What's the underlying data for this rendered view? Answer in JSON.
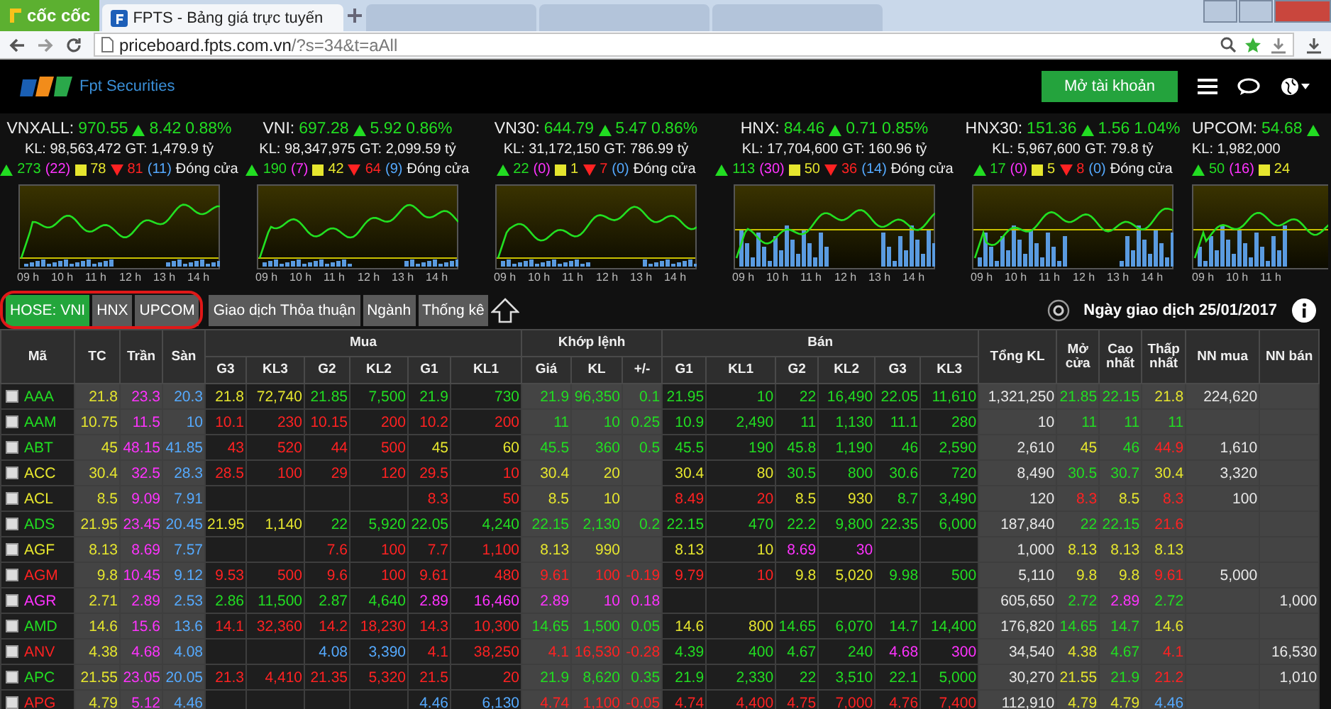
{
  "browser": {
    "brand": "cốc cốc",
    "tabs": [
      {
        "title": "FPTS - Bảng giá trực tuyến",
        "selected": true
      },
      {
        "selected": false
      },
      {
        "selected": false
      },
      {
        "selected": false
      }
    ],
    "url_host": "priceboard.fpts.com.vn",
    "url_path": "/?s=34&t=aAll"
  },
  "site": {
    "logo_text": "Fpt Securities",
    "open_account": "Mở tài khoản"
  },
  "indices": [
    {
      "name": "VNXALL:",
      "value": "970.55",
      "change": "8.42",
      "percent": "0.88%",
      "volume": "KL: 98,563,472",
      "value_traded": "GT: 1,479.9 tỷ",
      "advances": "273",
      "ceiling": "(22)",
      "unchanged": "78",
      "declines": "81",
      "floor": "(11)",
      "status": "Đóng cửa",
      "time_labels": [
        "09 h",
        "10 h",
        "11 h",
        "12 h",
        "13 h",
        "14 h"
      ]
    },
    {
      "name": "VNI:",
      "value": "697.28",
      "change": "5.92",
      "percent": "0.86%",
      "volume": "KL: 98,347,975",
      "value_traded": "GT: 2,099.59 tỷ",
      "advances": "190",
      "ceiling": "(7)",
      "unchanged": "42",
      "declines": "64",
      "floor": "(9)",
      "status": "Đóng cửa",
      "time_labels": [
        "09 h",
        "10 h",
        "11 h",
        "12 h",
        "13 h",
        "14 h"
      ]
    },
    {
      "name": "VN30:",
      "value": "644.79",
      "change": "5.47",
      "percent": "0.86%",
      "volume": "KL: 31,172,150",
      "value_traded": "GT: 786.99 tỷ",
      "advances": "22",
      "ceiling": "(0)",
      "unchanged": "1",
      "declines": "7",
      "floor": "(0)",
      "status": "Đóng cửa",
      "time_labels": [
        "09 h",
        "10 h",
        "11 h",
        "12 h",
        "13 h",
        "14 h"
      ]
    },
    {
      "name": "HNX:",
      "value": "84.46",
      "change": "0.71",
      "percent": "0.85%",
      "volume": "KL: 17,704,600",
      "value_traded": "GT: 160.96 tỷ",
      "advances": "113",
      "ceiling": "(30)",
      "unchanged": "50",
      "declines": "36",
      "floor": "(14)",
      "status": "Đóng cửa",
      "time_labels": [
        "09 h",
        "10 h",
        "11 h",
        "12 h",
        "13 h",
        "14 h"
      ]
    },
    {
      "name": "HNX30:",
      "value": "151.36",
      "change": "1.56",
      "percent": "1.04%",
      "volume": "KL: 5,967,600",
      "value_traded": "GT: 79.8 tỷ",
      "advances": "17",
      "ceiling": "(0)",
      "unchanged": "5",
      "declines": "8",
      "floor": "(0)",
      "status": "Đóng cửa",
      "time_labels": [
        "09 h",
        "10 h",
        "11 h",
        "12 h",
        "13 h",
        "14 h"
      ]
    },
    {
      "name": "UPCOM:",
      "value": "54.68",
      "volume": "KL: 1,982,000",
      "advances": "50",
      "ceiling": "(16)",
      "unchanged": "24",
      "time_labels": [
        "09 h",
        "10 h",
        "11 h"
      ]
    }
  ],
  "market_tabs": [
    {
      "label": "HOSE: VNI",
      "selected": true
    },
    {
      "label": "HNX",
      "selected": false
    },
    {
      "label": "UPCOM",
      "selected": false
    },
    {
      "label": "Giao dịch Thỏa thuận",
      "selected": false
    },
    {
      "label": "Ngành",
      "selected": false
    },
    {
      "label": "Thống kê",
      "selected": false
    }
  ],
  "trading_date": "Ngày giao dịch 25/01/2017",
  "table": {
    "groups": [
      "Mua",
      "Khớp lệnh",
      "Bán"
    ],
    "columns": [
      {
        "label": "Mã"
      },
      {
        "label": "TC"
      },
      {
        "label": "Trần"
      },
      {
        "label": "Sàn"
      },
      {
        "label": "G3"
      },
      {
        "label": "KL3"
      },
      {
        "label": "G2"
      },
      {
        "label": "KL2"
      },
      {
        "label": "G1"
      },
      {
        "label": "KL1"
      },
      {
        "label": "Giá"
      },
      {
        "label": "KL"
      },
      {
        "label": "+/-"
      },
      {
        "label": "G1"
      },
      {
        "label": "KL1"
      },
      {
        "label": "G2"
      },
      {
        "label": "KL2"
      },
      {
        "label": "G3"
      },
      {
        "label": "KL3"
      },
      {
        "label": "Tổng KL"
      },
      {
        "label": "Mở cửa"
      },
      {
        "label": "Cao nhất"
      },
      {
        "label": "Thấp nhất"
      },
      {
        "label": "NN mua"
      },
      {
        "label": "NN bán"
      }
    ],
    "rows": [
      {
        "cells": [
          {
            "text": "AAA",
            "color": "#22dd22",
            "checked": false
          },
          {
            "text": "21.8",
            "color": "#e6e62e"
          },
          {
            "text": "23.3",
            "color": "#ff33ff"
          },
          {
            "text": "20.3",
            "color": "#55aaff"
          },
          {
            "text": "21.8",
            "color": "#e6e62e"
          },
          {
            "text": "72,740",
            "color": "#e6e62e"
          },
          {
            "text": "21.85",
            "color": "#22dd22"
          },
          {
            "text": "7,500",
            "color": "#22dd22"
          },
          {
            "text": "21.9",
            "color": "#22dd22"
          },
          {
            "text": "730",
            "color": "#22dd22"
          },
          {
            "text": "21.9",
            "color": "#22dd22"
          },
          {
            "text": "96,350",
            "color": "#22dd22"
          },
          {
            "text": "0.1",
            "color": "#22dd22"
          },
          {
            "text": "21.95",
            "color": "#22dd22"
          },
          {
            "text": "10",
            "color": "#22dd22"
          },
          {
            "text": "22",
            "color": "#22dd22"
          },
          {
            "text": "16,490",
            "color": "#22dd22"
          },
          {
            "text": "22.05",
            "color": "#22dd22"
          },
          {
            "text": "11,610",
            "color": "#22dd22"
          },
          {
            "text": "1,321,250",
            "color": "#e8e8e8"
          },
          {
            "text": "21.85",
            "color": "#22dd22"
          },
          {
            "text": "22.15",
            "color": "#22dd22"
          },
          {
            "text": "21.8",
            "color": "#e6e62e"
          },
          {
            "text": "224,620",
            "color": "#e8e8e8"
          },
          null
        ]
      },
      {
        "cells": [
          {
            "text": "AAM",
            "color": "#22dd22",
            "checked": false
          },
          {
            "text": "10.75",
            "color": "#e6e62e"
          },
          {
            "text": "11.5",
            "color": "#ff33ff"
          },
          {
            "text": "10",
            "color": "#55aaff"
          },
          {
            "text": "10.1",
            "color": "#ff2222"
          },
          {
            "text": "230",
            "color": "#ff2222"
          },
          {
            "text": "10.15",
            "color": "#ff2222"
          },
          {
            "text": "200",
            "color": "#ff2222"
          },
          {
            "text": "10.2",
            "color": "#ff2222"
          },
          {
            "text": "200",
            "color": "#ff2222"
          },
          {
            "text": "11",
            "color": "#22dd22"
          },
          {
            "text": "10",
            "color": "#22dd22"
          },
          {
            "text": "0.25",
            "color": "#22dd22"
          },
          {
            "text": "10.9",
            "color": "#22dd22"
          },
          {
            "text": "2,490",
            "color": "#22dd22"
          },
          {
            "text": "11",
            "color": "#22dd22"
          },
          {
            "text": "1,130",
            "color": "#22dd22"
          },
          {
            "text": "11.1",
            "color": "#22dd22"
          },
          {
            "text": "280",
            "color": "#22dd22"
          },
          {
            "text": "10",
            "color": "#e8e8e8"
          },
          {
            "text": "11",
            "color": "#22dd22"
          },
          {
            "text": "11",
            "color": "#22dd22"
          },
          {
            "text": "11",
            "color": "#22dd22"
          },
          null,
          null
        ]
      },
      {
        "cells": [
          {
            "text": "ABT",
            "color": "#22dd22",
            "checked": false
          },
          {
            "text": "45",
            "color": "#e6e62e"
          },
          {
            "text": "48.15",
            "color": "#ff33ff"
          },
          {
            "text": "41.85",
            "color": "#55aaff"
          },
          {
            "text": "43",
            "color": "#ff2222"
          },
          {
            "text": "520",
            "color": "#ff2222"
          },
          {
            "text": "44",
            "color": "#ff2222"
          },
          {
            "text": "500",
            "color": "#ff2222"
          },
          {
            "text": "45",
            "color": "#e6e62e"
          },
          {
            "text": "60",
            "color": "#e6e62e"
          },
          {
            "text": "45.5",
            "color": "#22dd22"
          },
          {
            "text": "360",
            "color": "#22dd22"
          },
          {
            "text": "0.5",
            "color": "#22dd22"
          },
          {
            "text": "45.5",
            "color": "#22dd22"
          },
          {
            "text": "190",
            "color": "#22dd22"
          },
          {
            "text": "45.8",
            "color": "#22dd22"
          },
          {
            "text": "1,190",
            "color": "#22dd22"
          },
          {
            "text": "46",
            "color": "#22dd22"
          },
          {
            "text": "2,590",
            "color": "#22dd22"
          },
          {
            "text": "2,610",
            "color": "#e8e8e8"
          },
          {
            "text": "45",
            "color": "#e6e62e"
          },
          {
            "text": "46",
            "color": "#22dd22"
          },
          {
            "text": "44.9",
            "color": "#ff2222"
          },
          {
            "text": "1,610",
            "color": "#e8e8e8"
          },
          null
        ]
      },
      {
        "cells": [
          {
            "text": "ACC",
            "color": "#e6e62e",
            "checked": false
          },
          {
            "text": "30.4",
            "color": "#e6e62e"
          },
          {
            "text": "32.5",
            "color": "#ff33ff"
          },
          {
            "text": "28.3",
            "color": "#55aaff"
          },
          {
            "text": "28.5",
            "color": "#ff2222"
          },
          {
            "text": "100",
            "color": "#ff2222"
          },
          {
            "text": "29",
            "color": "#ff2222"
          },
          {
            "text": "120",
            "color": "#ff2222"
          },
          {
            "text": "29.5",
            "color": "#ff2222"
          },
          {
            "text": "10",
            "color": "#ff2222"
          },
          {
            "text": "30.4",
            "color": "#e6e62e"
          },
          {
            "text": "20",
            "color": "#e6e62e"
          },
          null,
          {
            "text": "30.4",
            "color": "#e6e62e"
          },
          {
            "text": "80",
            "color": "#e6e62e"
          },
          {
            "text": "30.5",
            "color": "#22dd22"
          },
          {
            "text": "800",
            "color": "#22dd22"
          },
          {
            "text": "30.6",
            "color": "#22dd22"
          },
          {
            "text": "720",
            "color": "#22dd22"
          },
          {
            "text": "8,490",
            "color": "#e8e8e8"
          },
          {
            "text": "30.5",
            "color": "#22dd22"
          },
          {
            "text": "30.7",
            "color": "#22dd22"
          },
          {
            "text": "30.4",
            "color": "#e6e62e"
          },
          {
            "text": "3,320",
            "color": "#e8e8e8"
          },
          null
        ]
      },
      {
        "cells": [
          {
            "text": "ACL",
            "color": "#e6e62e",
            "checked": false
          },
          {
            "text": "8.5",
            "color": "#e6e62e"
          },
          {
            "text": "9.09",
            "color": "#ff33ff"
          },
          {
            "text": "7.91",
            "color": "#55aaff"
          },
          null,
          null,
          null,
          null,
          {
            "text": "8.3",
            "color": "#ff2222"
          },
          {
            "text": "50",
            "color": "#ff2222"
          },
          {
            "text": "8.5",
            "color": "#e6e62e"
          },
          {
            "text": "10",
            "color": "#e6e62e"
          },
          null,
          {
            "text": "8.49",
            "color": "#ff2222"
          },
          {
            "text": "20",
            "color": "#ff2222"
          },
          {
            "text": "8.5",
            "color": "#e6e62e"
          },
          {
            "text": "930",
            "color": "#e6e62e"
          },
          {
            "text": "8.7",
            "color": "#22dd22"
          },
          {
            "text": "3,490",
            "color": "#22dd22"
          },
          {
            "text": "120",
            "color": "#e8e8e8"
          },
          {
            "text": "8.3",
            "color": "#ff2222"
          },
          {
            "text": "8.5",
            "color": "#e6e62e"
          },
          {
            "text": "8.3",
            "color": "#ff2222"
          },
          {
            "text": "100",
            "color": "#e8e8e8"
          },
          null
        ]
      },
      {
        "cells": [
          {
            "text": "ADS",
            "color": "#22dd22",
            "checked": false
          },
          {
            "text": "21.95",
            "color": "#e6e62e"
          },
          {
            "text": "23.45",
            "color": "#ff33ff"
          },
          {
            "text": "20.45",
            "color": "#55aaff"
          },
          {
            "text": "21.95",
            "color": "#e6e62e"
          },
          {
            "text": "1,140",
            "color": "#e6e62e"
          },
          {
            "text": "22",
            "color": "#22dd22"
          },
          {
            "text": "5,920",
            "color": "#22dd22"
          },
          {
            "text": "22.05",
            "color": "#22dd22"
          },
          {
            "text": "4,240",
            "color": "#22dd22"
          },
          {
            "text": "22.15",
            "color": "#22dd22"
          },
          {
            "text": "2,130",
            "color": "#22dd22"
          },
          {
            "text": "0.2",
            "color": "#22dd22"
          },
          {
            "text": "22.15",
            "color": "#22dd22"
          },
          {
            "text": "470",
            "color": "#22dd22"
          },
          {
            "text": "22.2",
            "color": "#22dd22"
          },
          {
            "text": "9,800",
            "color": "#22dd22"
          },
          {
            "text": "22.35",
            "color": "#22dd22"
          },
          {
            "text": "6,000",
            "color": "#22dd22"
          },
          {
            "text": "187,840",
            "color": "#e8e8e8"
          },
          {
            "text": "22",
            "color": "#22dd22"
          },
          {
            "text": "22.15",
            "color": "#22dd22"
          },
          {
            "text": "21.6",
            "color": "#ff2222"
          },
          null,
          null
        ]
      },
      {
        "cells": [
          {
            "text": "AGF",
            "color": "#e6e62e",
            "checked": false
          },
          {
            "text": "8.13",
            "color": "#e6e62e"
          },
          {
            "text": "8.69",
            "color": "#ff33ff"
          },
          {
            "text": "7.57",
            "color": "#55aaff"
          },
          null,
          null,
          {
            "text": "7.6",
            "color": "#ff2222"
          },
          {
            "text": "100",
            "color": "#ff2222"
          },
          {
            "text": "7.7",
            "color": "#ff2222"
          },
          {
            "text": "1,100",
            "color": "#ff2222"
          },
          {
            "text": "8.13",
            "color": "#e6e62e"
          },
          {
            "text": "990",
            "color": "#e6e62e"
          },
          null,
          {
            "text": "8.13",
            "color": "#e6e62e"
          },
          {
            "text": "10",
            "color": "#e6e62e"
          },
          {
            "text": "8.69",
            "color": "#ff33ff"
          },
          {
            "text": "30",
            "color": "#ff33ff"
          },
          null,
          null,
          {
            "text": "1,000",
            "color": "#e8e8e8"
          },
          {
            "text": "8.13",
            "color": "#e6e62e"
          },
          {
            "text": "8.13",
            "color": "#e6e62e"
          },
          {
            "text": "8.13",
            "color": "#e6e62e"
          },
          null,
          null
        ]
      },
      {
        "cells": [
          {
            "text": "AGM",
            "color": "#ff2222",
            "checked": false
          },
          {
            "text": "9.8",
            "color": "#e6e62e"
          },
          {
            "text": "10.45",
            "color": "#ff33ff"
          },
          {
            "text": "9.12",
            "color": "#55aaff"
          },
          {
            "text": "9.53",
            "color": "#ff2222"
          },
          {
            "text": "500",
            "color": "#ff2222"
          },
          {
            "text": "9.6",
            "color": "#ff2222"
          },
          {
            "text": "100",
            "color": "#ff2222"
          },
          {
            "text": "9.61",
            "color": "#ff2222"
          },
          {
            "text": "480",
            "color": "#ff2222"
          },
          {
            "text": "9.61",
            "color": "#ff2222"
          },
          {
            "text": "100",
            "color": "#ff2222"
          },
          {
            "text": "-0.19",
            "color": "#ff2222"
          },
          {
            "text": "9.79",
            "color": "#ff2222"
          },
          {
            "text": "10",
            "color": "#ff2222"
          },
          {
            "text": "9.8",
            "color": "#e6e62e"
          },
          {
            "text": "5,020",
            "color": "#e6e62e"
          },
          {
            "text": "9.98",
            "color": "#22dd22"
          },
          {
            "text": "500",
            "color": "#22dd22"
          },
          {
            "text": "5,110",
            "color": "#e8e8e8"
          },
          {
            "text": "9.8",
            "color": "#e6e62e"
          },
          {
            "text": "9.8",
            "color": "#e6e62e"
          },
          {
            "text": "9.61",
            "color": "#ff2222"
          },
          {
            "text": "5,000",
            "color": "#e8e8e8"
          },
          null
        ]
      },
      {
        "cells": [
          {
            "text": "AGR",
            "color": "#ff33ff",
            "checked": false
          },
          {
            "text": "2.71",
            "color": "#e6e62e"
          },
          {
            "text": "2.89",
            "color": "#ff33ff"
          },
          {
            "text": "2.53",
            "color": "#55aaff"
          },
          {
            "text": "2.86",
            "color": "#22dd22"
          },
          {
            "text": "11,500",
            "color": "#22dd22"
          },
          {
            "text": "2.87",
            "color": "#22dd22"
          },
          {
            "text": "4,640",
            "color": "#22dd22"
          },
          {
            "text": "2.89",
            "color": "#ff33ff"
          },
          {
            "text": "16,460",
            "color": "#ff33ff"
          },
          {
            "text": "2.89",
            "color": "#ff33ff"
          },
          {
            "text": "10",
            "color": "#ff33ff"
          },
          {
            "text": "0.18",
            "color": "#ff33ff"
          },
          null,
          null,
          null,
          null,
          null,
          null,
          {
            "text": "605,650",
            "color": "#e8e8e8"
          },
          {
            "text": "2.72",
            "color": "#22dd22"
          },
          {
            "text": "2.89",
            "color": "#ff33ff"
          },
          {
            "text": "2.72",
            "color": "#22dd22"
          },
          null,
          {
            "text": "1,000",
            "color": "#e8e8e8"
          }
        ]
      },
      {
        "cells": [
          {
            "text": "AMD",
            "color": "#22dd22",
            "checked": false
          },
          {
            "text": "14.6",
            "color": "#e6e62e"
          },
          {
            "text": "15.6",
            "color": "#ff33ff"
          },
          {
            "text": "13.6",
            "color": "#55aaff"
          },
          {
            "text": "14.1",
            "color": "#ff2222"
          },
          {
            "text": "32,360",
            "color": "#ff2222"
          },
          {
            "text": "14.2",
            "color": "#ff2222"
          },
          {
            "text": "18,230",
            "color": "#ff2222"
          },
          {
            "text": "14.3",
            "color": "#ff2222"
          },
          {
            "text": "10,300",
            "color": "#ff2222"
          },
          {
            "text": "14.65",
            "color": "#22dd22"
          },
          {
            "text": "1,500",
            "color": "#22dd22"
          },
          {
            "text": "0.05",
            "color": "#22dd22"
          },
          {
            "text": "14.6",
            "color": "#e6e62e"
          },
          {
            "text": "800",
            "color": "#e6e62e"
          },
          {
            "text": "14.65",
            "color": "#22dd22"
          },
          {
            "text": "6,070",
            "color": "#22dd22"
          },
          {
            "text": "14.7",
            "color": "#22dd22"
          },
          {
            "text": "14,400",
            "color": "#22dd22"
          },
          {
            "text": "176,820",
            "color": "#e8e8e8"
          },
          {
            "text": "14.65",
            "color": "#22dd22"
          },
          {
            "text": "14.7",
            "color": "#22dd22"
          },
          {
            "text": "14.6",
            "color": "#e6e62e"
          },
          null,
          null
        ]
      },
      {
        "cells": [
          {
            "text": "ANV",
            "color": "#ff2222",
            "checked": false
          },
          {
            "text": "4.38",
            "color": "#e6e62e"
          },
          {
            "text": "4.68",
            "color": "#ff33ff"
          },
          {
            "text": "4.08",
            "color": "#55aaff"
          },
          null,
          null,
          {
            "text": "4.08",
            "color": "#55aaff"
          },
          {
            "text": "3,390",
            "color": "#55aaff"
          },
          {
            "text": "4.1",
            "color": "#ff2222"
          },
          {
            "text": "38,250",
            "color": "#ff2222"
          },
          {
            "text": "4.1",
            "color": "#ff2222"
          },
          {
            "text": "16,530",
            "color": "#ff2222"
          },
          {
            "text": "-0.28",
            "color": "#ff2222"
          },
          {
            "text": "4.39",
            "color": "#22dd22"
          },
          {
            "text": "400",
            "color": "#22dd22"
          },
          {
            "text": "4.67",
            "color": "#22dd22"
          },
          {
            "text": "240",
            "color": "#22dd22"
          },
          {
            "text": "4.68",
            "color": "#ff33ff"
          },
          {
            "text": "300",
            "color": "#ff33ff"
          },
          {
            "text": "34,540",
            "color": "#e8e8e8"
          },
          {
            "text": "4.38",
            "color": "#e6e62e"
          },
          {
            "text": "4.67",
            "color": "#22dd22"
          },
          {
            "text": "4.1",
            "color": "#ff2222"
          },
          null,
          {
            "text": "16,530",
            "color": "#e8e8e8"
          }
        ]
      },
      {
        "cells": [
          {
            "text": "APC",
            "color": "#22dd22",
            "checked": false
          },
          {
            "text": "21.55",
            "color": "#e6e62e"
          },
          {
            "text": "23.05",
            "color": "#ff33ff"
          },
          {
            "text": "20.05",
            "color": "#55aaff"
          },
          {
            "text": "21.3",
            "color": "#ff2222"
          },
          {
            "text": "4,410",
            "color": "#ff2222"
          },
          {
            "text": "21.35",
            "color": "#ff2222"
          },
          {
            "text": "5,320",
            "color": "#ff2222"
          },
          {
            "text": "21.5",
            "color": "#ff2222"
          },
          {
            "text": "20",
            "color": "#ff2222"
          },
          {
            "text": "21.9",
            "color": "#22dd22"
          },
          {
            "text": "8,620",
            "color": "#22dd22"
          },
          {
            "text": "0.35",
            "color": "#22dd22"
          },
          {
            "text": "21.9",
            "color": "#22dd22"
          },
          {
            "text": "2,330",
            "color": "#22dd22"
          },
          {
            "text": "22",
            "color": "#22dd22"
          },
          {
            "text": "3,510",
            "color": "#22dd22"
          },
          {
            "text": "22.1",
            "color": "#22dd22"
          },
          {
            "text": "5,000",
            "color": "#22dd22"
          },
          {
            "text": "30,270",
            "color": "#e8e8e8"
          },
          {
            "text": "21.55",
            "color": "#e6e62e"
          },
          {
            "text": "21.9",
            "color": "#22dd22"
          },
          {
            "text": "21.2",
            "color": "#ff2222"
          },
          null,
          {
            "text": "1,010",
            "color": "#e8e8e8"
          }
        ]
      },
      {
        "cells": [
          {
            "text": "APG",
            "color": "#ff2222",
            "checked": false
          },
          {
            "text": "4.79",
            "color": "#e6e62e"
          },
          {
            "text": "5.12",
            "color": "#ff33ff"
          },
          {
            "text": "4.46",
            "color": "#55aaff"
          },
          null,
          null,
          null,
          null,
          {
            "text": "4.46",
            "color": "#55aaff"
          },
          {
            "text": "6,130",
            "color": "#55aaff"
          },
          {
            "text": "4.74",
            "color": "#ff2222"
          },
          {
            "text": "1,100",
            "color": "#ff2222"
          },
          {
            "text": "-0.05",
            "color": "#ff2222"
          },
          {
            "text": "4.74",
            "color": "#ff2222"
          },
          {
            "text": "4,400",
            "color": "#ff2222"
          },
          {
            "text": "4.75",
            "color": "#ff2222"
          },
          {
            "text": "7,000",
            "color": "#ff2222"
          },
          {
            "text": "4.76",
            "color": "#ff2222"
          },
          {
            "text": "7,400",
            "color": "#ff2222"
          },
          {
            "text": "112,910",
            "color": "#e8e8e8"
          },
          {
            "text": "4.79",
            "color": "#e6e62e"
          },
          {
            "text": "4.79",
            "color": "#e6e62e"
          },
          {
            "text": "4.46",
            "color": "#55aaff"
          },
          null,
          null
        ]
      }
    ]
  }
}
